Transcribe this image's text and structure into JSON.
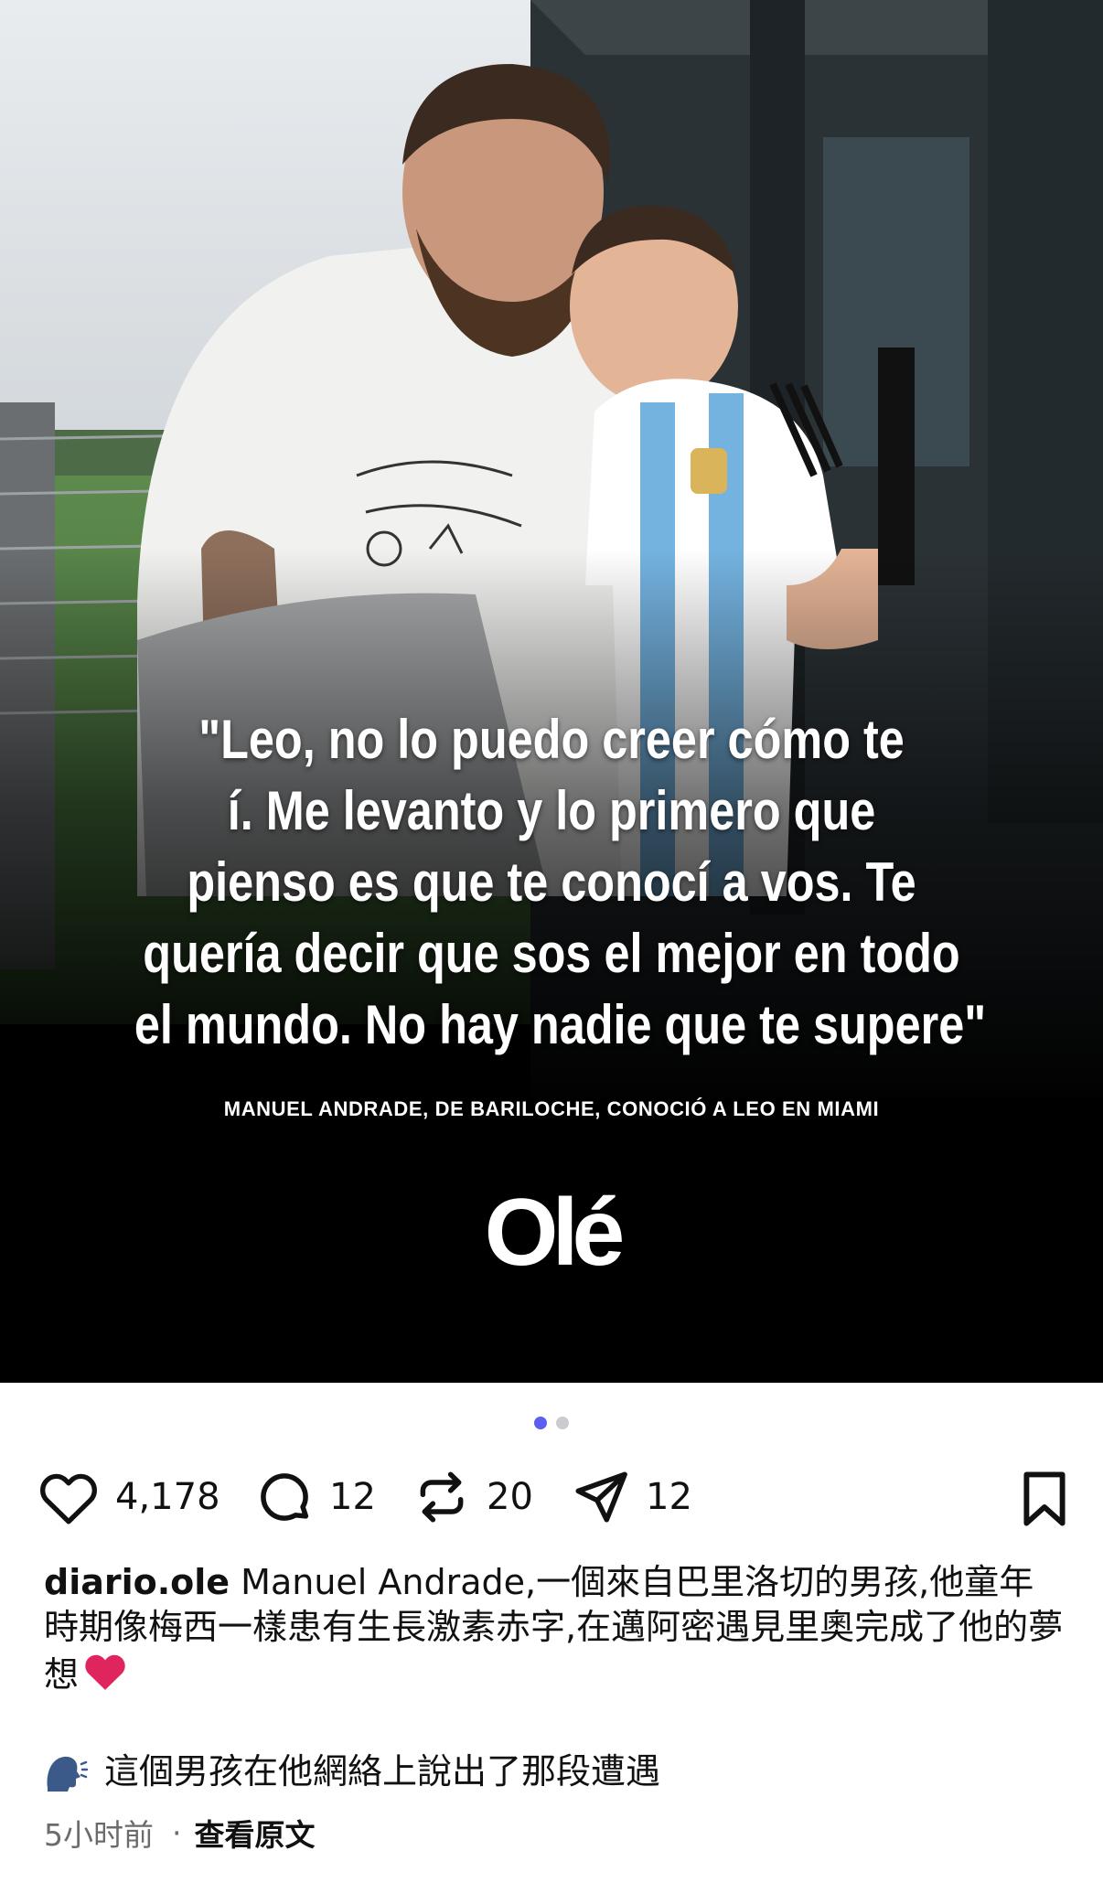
{
  "post": {
    "quote_lines": [
      "\"Leo, no lo puedo creer cómo te",
      "í. Me levanto y lo primero que",
      "pienso es que te conocí a vos. Te",
      "quería decir que sos el mejor en todo",
      "el mundo. No hay nadie que te supere\""
    ],
    "credit": "MANUEL ANDRADE, DE BARILOCHE, CONOCIÓ A LEO EN MIAMI",
    "brand": "Olé",
    "carousel": {
      "count": 2,
      "active": 1
    }
  },
  "actions": {
    "likes": "4,178",
    "comments": "12",
    "reposts": "20",
    "shares": "12"
  },
  "caption": {
    "username": "diario.ole",
    "text": " Manuel Andrade,一個來自巴里洛切的男孩,他童年時期像梅西一樣患有生長激素赤字,在邁阿密遇見里奧完成了他的夢想",
    "emoji": "red-heart",
    "subline": "這個男孩在他網絡上說出了那段遭遇",
    "subline_icon": "speaking-head-icon",
    "time": "5小时前",
    "separator": "·",
    "translate_label": "查看原文"
  },
  "colors": {
    "accent_dot": "#5b5ef0",
    "heart": "#e0245e"
  }
}
